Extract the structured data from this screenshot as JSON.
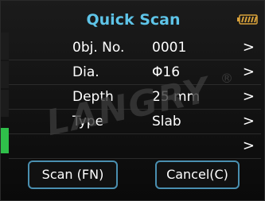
{
  "header": {
    "title": "Quick Scan"
  },
  "rows": [
    {
      "label": "0bj. No.",
      "value": "0001",
      "chevron": ">"
    },
    {
      "label": "Dia.",
      "value": "Φ16",
      "chevron": ">"
    },
    {
      "label": "Depth",
      "value": "25 mm",
      "chevron": ">"
    },
    {
      "label": "Type",
      "value": "Slab",
      "chevron": ">"
    },
    {
      "label": "",
      "value": "",
      "chevron": ">"
    }
  ],
  "watermark": {
    "text": "LANGRY",
    "mark": "®"
  },
  "buttons": {
    "scan": "Scan (FN)",
    "cancel": "Cancel(C)"
  },
  "colors": {
    "accent": "#5ec4e8",
    "battery": "#d8a13a",
    "strip_active": "#2fbf4a"
  },
  "icons": {
    "battery": "battery-icon"
  }
}
